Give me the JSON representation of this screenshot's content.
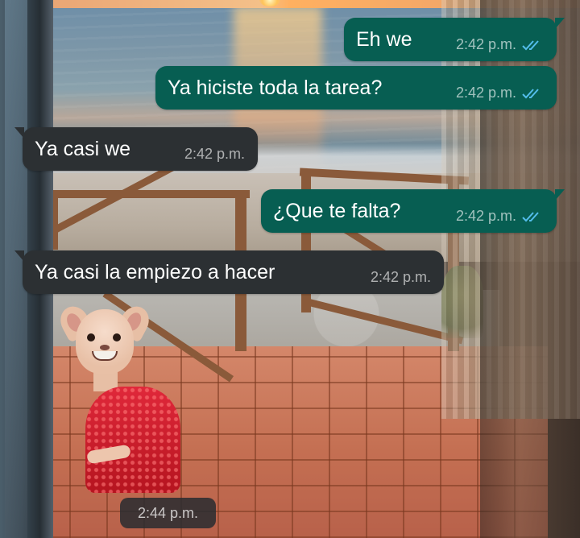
{
  "chat": {
    "messages": [
      {
        "direction": "outgoing",
        "text": "Eh we",
        "time": "2:42 p.m.",
        "status": "read"
      },
      {
        "direction": "outgoing",
        "text": "Ya hiciste toda la tarea?",
        "time": "2:42 p.m.",
        "status": "read"
      },
      {
        "direction": "incoming",
        "text": "Ya casi we",
        "time": "2:42 p.m."
      },
      {
        "direction": "outgoing",
        "text": "¿Que te falta?",
        "time": "2:42 p.m.",
        "status": "read"
      },
      {
        "direction": "incoming",
        "text": "Ya casi la empiezo a hacer",
        "time": "2:42 p.m."
      }
    ],
    "sticker": {
      "time": "2:44 p.m.",
      "icon": "dog-in-red-dress-sticker"
    }
  },
  "colors": {
    "outgoing_bubble": "#075e52",
    "incoming_bubble": "#2c3033",
    "read_ticks": "#53bdeb"
  },
  "wallpaper": "sunset-beach-terrace-photo"
}
